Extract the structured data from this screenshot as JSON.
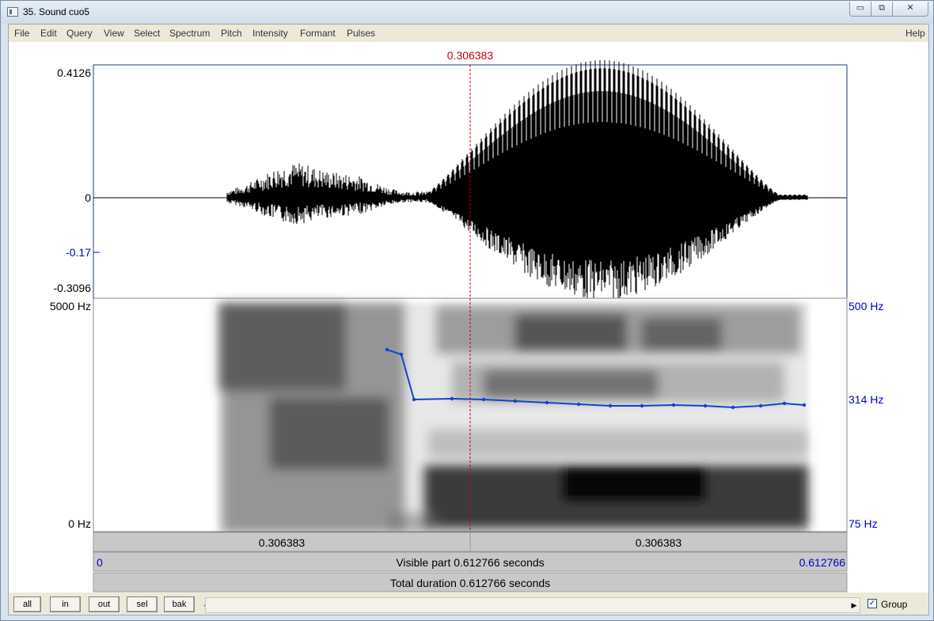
{
  "window": {
    "title": "35. Sound cuo5",
    "controls": {
      "minimize": "▭",
      "maximize": "⧉",
      "close": "✕"
    }
  },
  "menu": {
    "items": [
      "File",
      "Edit",
      "Query",
      "View",
      "Select",
      "Spectrum",
      "Pitch",
      "Intensity",
      "Formant",
      "Pulses"
    ],
    "help": "Help"
  },
  "cursor": {
    "time_label": "0.306383"
  },
  "waveform": {
    "y_max": "0.4126",
    "y_zero": "0",
    "y_cursor": "-0.17",
    "y_min": "-0.3096"
  },
  "spectrogram": {
    "freq_top": "5000 Hz",
    "freq_bottom": "0 Hz",
    "pitch_top": "500 Hz",
    "pitch_mid": "314 Hz",
    "pitch_bottom": "75 Hz"
  },
  "time_bar": {
    "left_part": "0.306383",
    "right_part": "0.306383",
    "visible_start": "0",
    "visible_label": "Visible part 0.612766 seconds",
    "visible_end": "0.612766",
    "total_label": "Total duration 0.612766 seconds"
  },
  "buttons": {
    "all": "all",
    "in": "in",
    "out": "out",
    "sel": "sel",
    "bak": "bak"
  },
  "scroll": {
    "left_arrow": "◀",
    "right_arrow": "▶"
  },
  "group": {
    "label": "Group",
    "checked": "✓"
  },
  "colors": {
    "cursor": "#cc0000",
    "pitch": "#1144cc",
    "axis_blue": "#0000cc",
    "panel_gray": "#c8c8c8"
  }
}
